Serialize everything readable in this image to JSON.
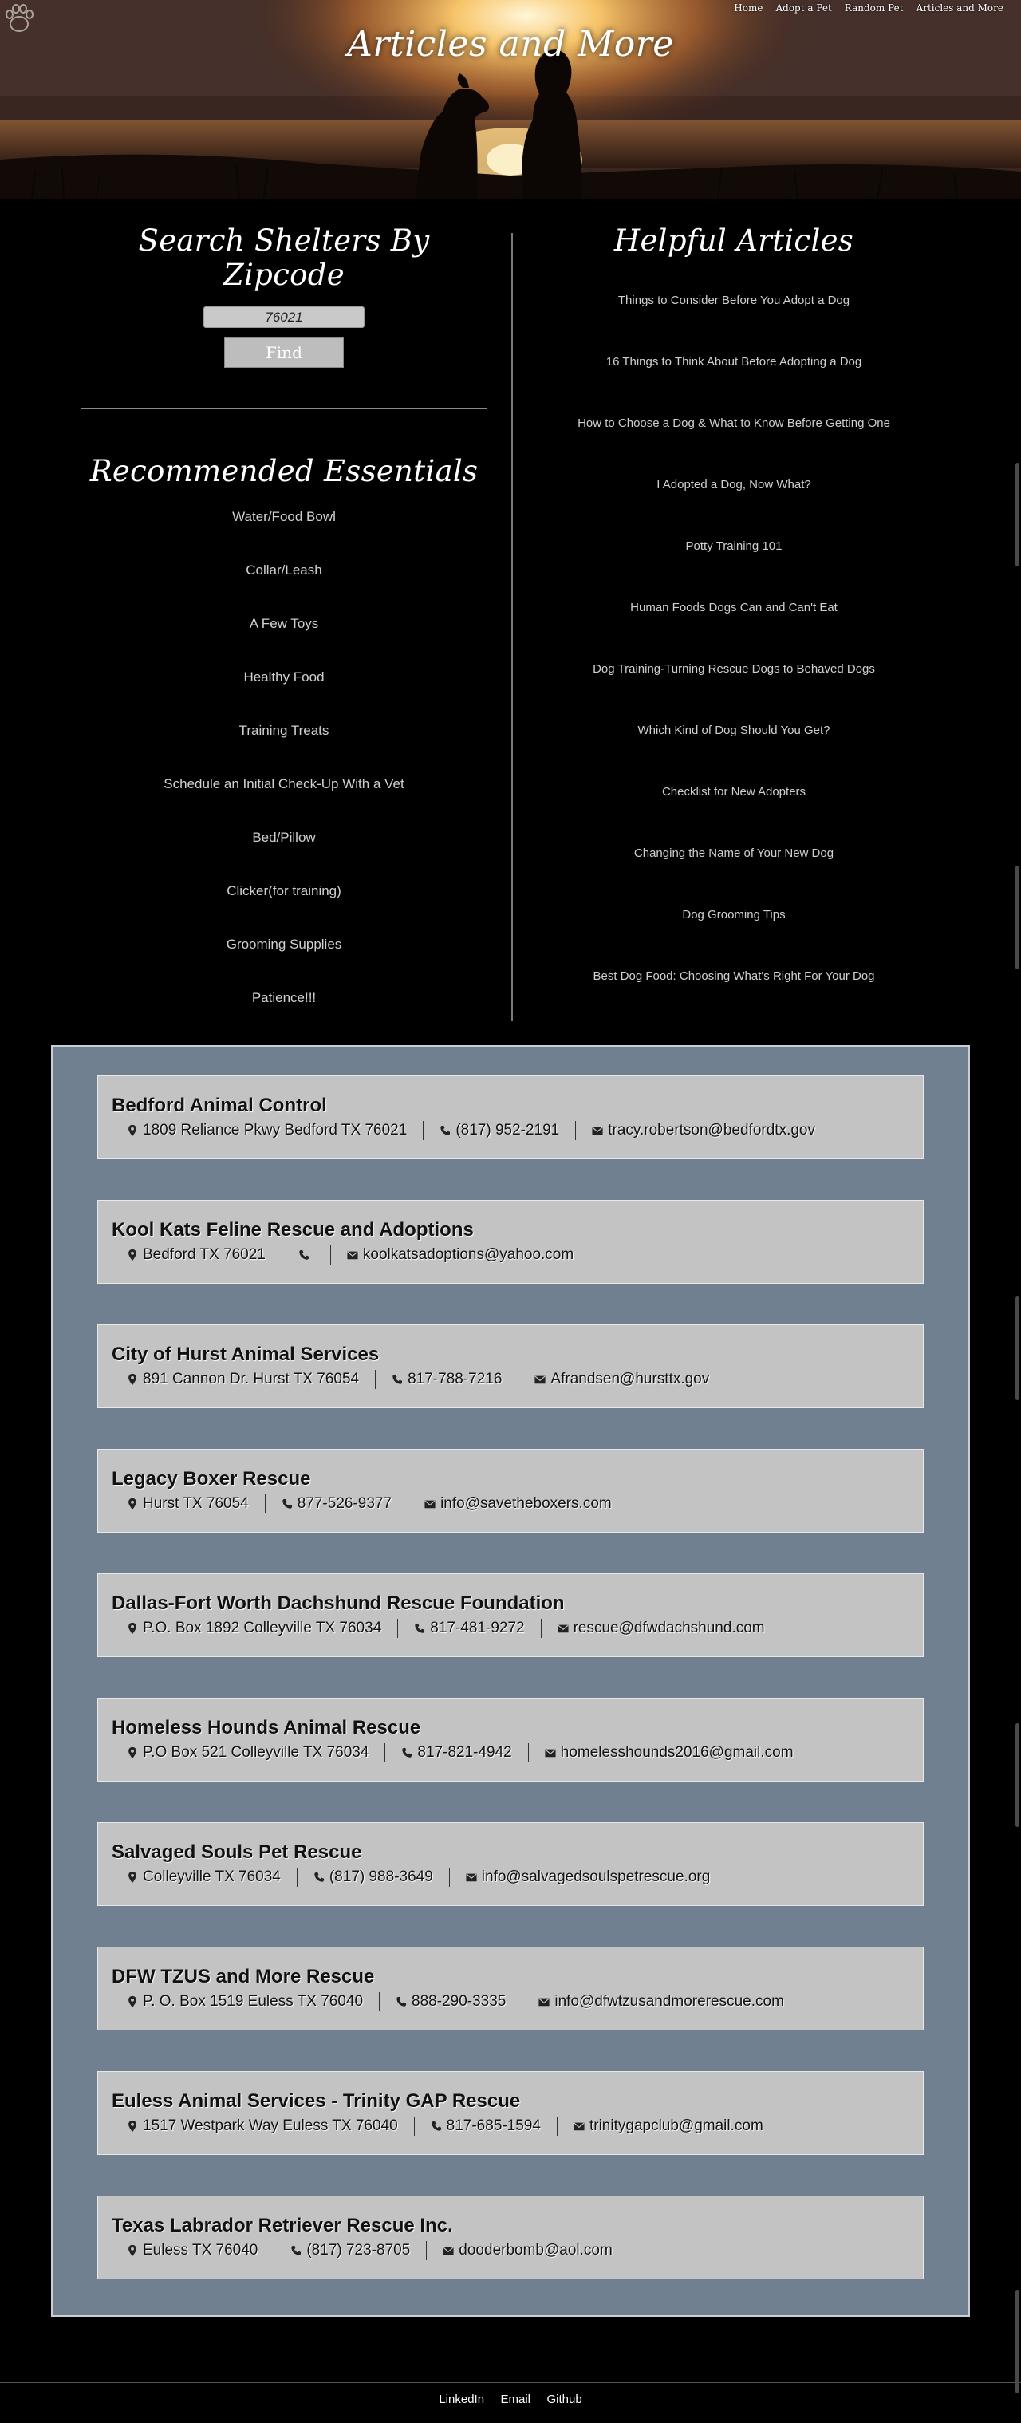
{
  "nav": {
    "items": [
      "Home",
      "Adopt a Pet",
      "Random Pet",
      "Articles and More"
    ]
  },
  "hero": {
    "title": "Articles and More"
  },
  "search": {
    "heading": "Search Shelters By Zipcode",
    "zip_value": "76021",
    "button_label": "Find"
  },
  "essentials": {
    "heading": "Recommended Essentials",
    "items": [
      "Water/Food Bowl",
      "Collar/Leash",
      "A Few Toys",
      "Healthy Food",
      "Training Treats",
      "Schedule an Initial Check-Up With a Vet",
      "Bed/Pillow",
      "Clicker(for training)",
      "Grooming Supplies",
      "Patience!!!"
    ]
  },
  "articles": {
    "heading": "Helpful Articles",
    "items": [
      "Things to Consider Before You Adopt a Dog",
      "16 Things to Think About Before Adopting a Dog",
      "How to Choose a Dog & What to Know Before Getting One",
      "I Adopted a Dog, Now What?",
      "Potty Training 101",
      "Human Foods Dogs Can and Can't Eat",
      "Dog Training-Turning Rescue Dogs to Behaved Dogs",
      "Which Kind of Dog Should You Get?",
      "Checklist for New Adopters",
      "Changing the Name of Your New Dog",
      "Dog Grooming Tips",
      "Best Dog Food: Choosing What's Right For Your Dog"
    ]
  },
  "shelters": [
    {
      "name": "Bedford Animal Control",
      "address": "1809 Reliance Pkwy Bedford TX 76021",
      "phone": "(817) 952-2191",
      "email": "tracy.robertson@bedfordtx.gov"
    },
    {
      "name": "Kool Kats Feline Rescue and Adoptions",
      "address": "Bedford TX 76021",
      "phone": "",
      "email": "koolkatsadoptions@yahoo.com"
    },
    {
      "name": "City of Hurst Animal Services",
      "address": "891 Cannon Dr. Hurst TX 76054",
      "phone": "817-788-7216",
      "email": "Afrandsen@hursttx.gov"
    },
    {
      "name": "Legacy Boxer Rescue",
      "address": "Hurst TX 76054",
      "phone": "877-526-9377",
      "email": "info@savetheboxers.com"
    },
    {
      "name": "Dallas-Fort Worth Dachshund Rescue Foundation",
      "address": "P.O. Box 1892 Colleyville TX 76034",
      "phone": "817-481-9272",
      "email": "rescue@dfwdachshund.com"
    },
    {
      "name": "Homeless Hounds Animal Rescue",
      "address": "P.O Box 521 Colleyville TX 76034",
      "phone": "817-821-4942",
      "email": "homelesshounds2016@gmail.com"
    },
    {
      "name": "Salvaged Souls Pet Rescue",
      "address": "Colleyville TX 76034",
      "phone": "(817) 988-3649",
      "email": "info@salvagedsoulspetrescue.org"
    },
    {
      "name": "DFW TZUS and More Rescue",
      "address": "P. O. Box 1519 Euless TX 76040",
      "phone": "888-290-3335",
      "email": "info@dfwtzusandmorerescue.com"
    },
    {
      "name": "Euless Animal Services - Trinity GAP Rescue",
      "address": "1517 Westpark Way Euless TX 76040",
      "phone": "817-685-1594",
      "email": "trinitygapclub@gmail.com"
    },
    {
      "name": "Texas Labrador Retriever Rescue Inc.",
      "address": "Euless TX 76040",
      "phone": "(817) 723-8705",
      "email": "dooderbomb@aol.com"
    }
  ],
  "footer": {
    "links": [
      "LinkedIn",
      "Email",
      "Github"
    ]
  },
  "colors": {
    "page_bg": "#000000",
    "panel_bg": "#708090",
    "card_bg": "#c3c3c3"
  },
  "icons": [
    "map-marker-icon",
    "phone-icon",
    "envelope-icon",
    "paw-logo-icon"
  ]
}
